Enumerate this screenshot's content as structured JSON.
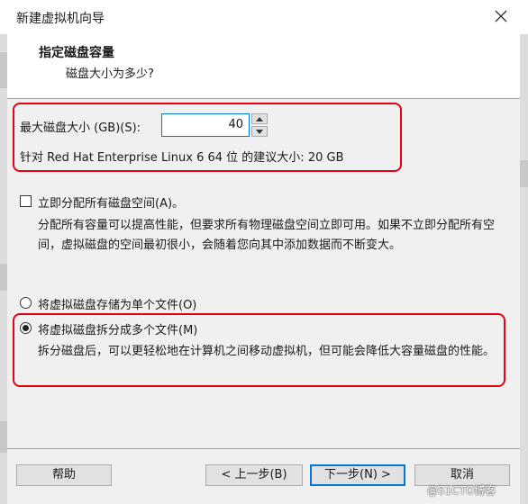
{
  "window": {
    "title": "新建虚拟机向导"
  },
  "header": {
    "title": "指定磁盘容量",
    "subtitle": "磁盘大小为多少?"
  },
  "disk": {
    "max_size_label": "最大磁盘大小 (GB)(S):",
    "max_size_value": "40",
    "recommended_text": "针对 Red Hat Enterprise Linux 6 64 位 的建议大小: 20 GB"
  },
  "allocate": {
    "label": "立即分配所有磁盘空间(A)。",
    "checked": false,
    "description": "分配所有容量可以提高性能，但要求所有物理磁盘空间立即可用。如果不立即分配所有空间，虚拟磁盘的空间最初很小，会随着您向其中添加数据而不断变大。"
  },
  "storage": {
    "single_file_label": "将虚拟磁盘存储为单个文件(O)",
    "multi_file_label": "将虚拟磁盘拆分成多个文件(M)",
    "selected": "multi",
    "multi_file_description": "拆分磁盘后，可以更轻松地在计算机之间移动虚拟机，但可能会降低大容量磁盘的性能。"
  },
  "buttons": {
    "help": "帮助",
    "back": "< 上一步(B)",
    "next": "下一步(N) >",
    "cancel": "取消"
  },
  "watermark": "@51CTO博客",
  "colors": {
    "highlight": "#e60012",
    "accent": "#0078d7"
  },
  "icons": [
    "close-icon",
    "spin-up-icon",
    "spin-down-icon"
  ]
}
